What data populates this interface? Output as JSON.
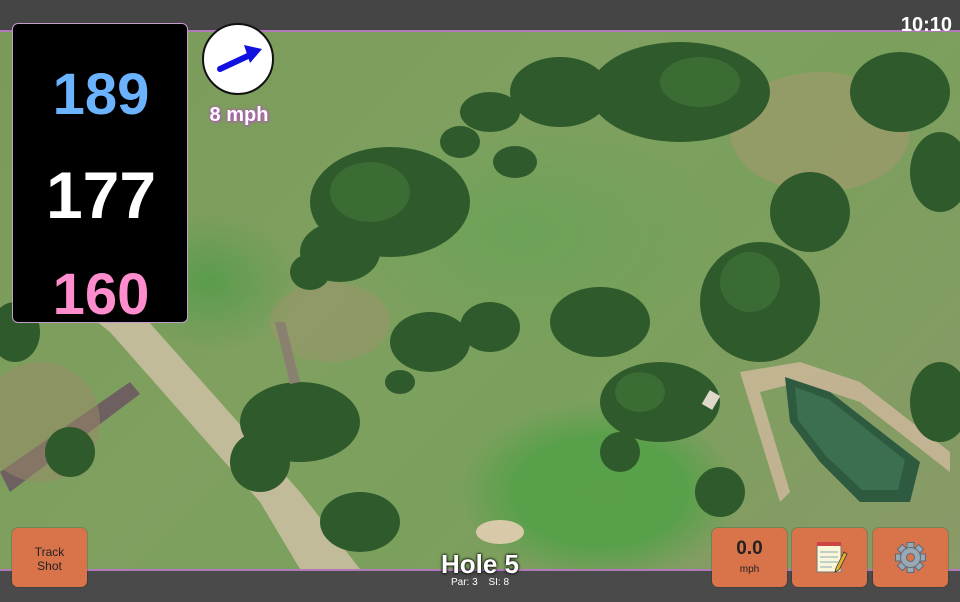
{
  "status": {
    "time": "10:10"
  },
  "distances": {
    "back": "189",
    "middle": "177",
    "front": "160"
  },
  "wind": {
    "speed": "8 mph",
    "icon": "wind-direction-arrow-icon"
  },
  "hole": {
    "title": "Hole 5",
    "par": "Par: 3",
    "stroke_index": "SI: 8"
  },
  "buttons": {
    "track_shot_line1": "Track",
    "track_shot_line2": "Shot",
    "speed_value": "0.0",
    "speed_unit": "mph",
    "notes_icon": "notepad-icon",
    "settings_icon": "gear-icon"
  },
  "colors": {
    "back_distance": "#6bb3ff",
    "middle_distance": "#ffffff",
    "front_distance": "#ff8ccc",
    "button": "#d9734a",
    "accent_border": "#b07ab8"
  }
}
